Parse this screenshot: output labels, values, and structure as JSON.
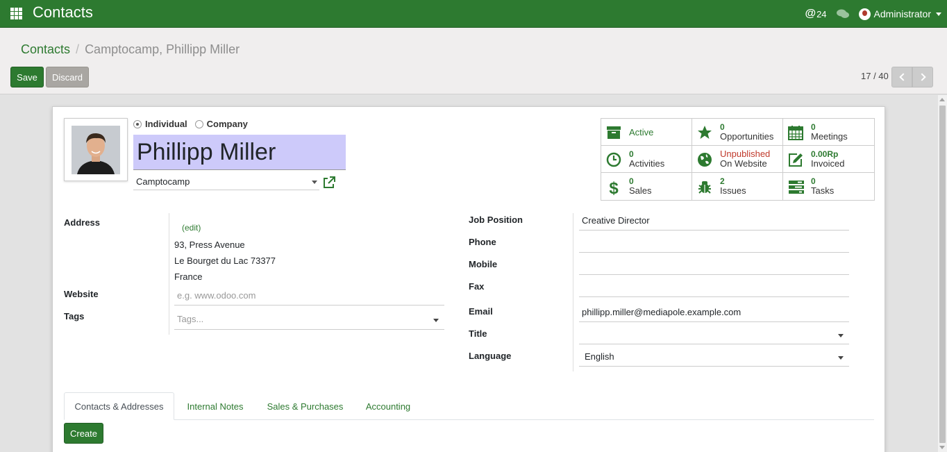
{
  "navbar": {
    "app_title": "Contacts",
    "mentions_count": "24",
    "user_name": "Administrator"
  },
  "breadcrumb": {
    "parent": "Contacts",
    "separator": "/",
    "current": "Camptocamp, Phillipp Miller"
  },
  "actions": {
    "save_label": "Save",
    "discard_label": "Discard"
  },
  "pager": {
    "value": "17 / 40"
  },
  "partner": {
    "type_individual": "Individual",
    "type_company": "Company",
    "selected_type": "Individual",
    "name": "Phillipp Miller",
    "company": "Camptocamp"
  },
  "smart_buttons": {
    "active": "Active",
    "opportunities_count": "0",
    "opportunities_label": "Opportunities",
    "meetings_count": "0",
    "meetings_label": "Meetings",
    "activities_count": "0",
    "activities_label": "Activities",
    "website_status": "Unpublished",
    "website_label": "On Website",
    "invoiced_amount": "0.00Rp",
    "invoiced_label": "Invoiced",
    "sales_count": "0",
    "sales_label": "Sales",
    "issues_count": "2",
    "issues_label": "Issues",
    "tasks_count": "0",
    "tasks_label": "Tasks"
  },
  "left_fields": {
    "address_label": "Address",
    "address_edit": "(edit)",
    "street": "93, Press Avenue",
    "city_zip": "Le Bourget du Lac  73377",
    "country": "France",
    "website_label": "Website",
    "website_placeholder": "e.g. www.odoo.com",
    "tags_label": "Tags",
    "tags_placeholder": "Tags..."
  },
  "right_fields": {
    "job_position_label": "Job Position",
    "job_position": "Creative Director",
    "phone_label": "Phone",
    "phone": "",
    "mobile_label": "Mobile",
    "mobile": "",
    "fax_label": "Fax",
    "fax": "",
    "email_label": "Email",
    "email": "phillipp.miller@mediapole.example.com",
    "title_label": "Title",
    "title": "",
    "language_label": "Language",
    "language": "English"
  },
  "tabs": [
    {
      "label": "Contacts & Addresses"
    },
    {
      "label": "Internal Notes"
    },
    {
      "label": "Sales & Purchases"
    },
    {
      "label": "Accounting"
    }
  ],
  "create_label": "Create",
  "colors": {
    "brand": "#2d7a30",
    "unpublished": "#c0392b",
    "name_highlight": "#cdcafa"
  }
}
